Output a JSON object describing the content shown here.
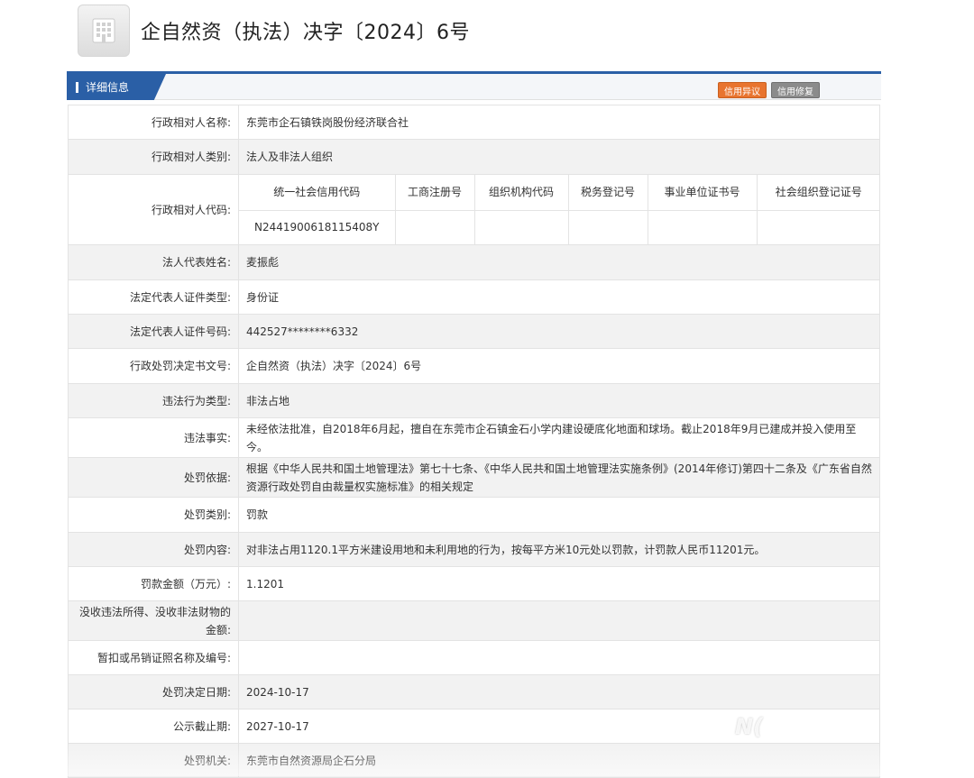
{
  "header": {
    "title": "企自然资（执法）决字〔2024〕6号",
    "logo_icon": "building-icon"
  },
  "section": {
    "tab_label": "详细信息",
    "btn_objection": "信用异议",
    "btn_repair": "信用修复",
    "accent_color": "#2a5fa6",
    "objection_color": "#e8742f",
    "repair_color": "#8b8b8b"
  },
  "rows": {
    "name_label": "行政相对人名称:",
    "name_value": "东莞市企石镇铁岗股份经济联合社",
    "type_label": "行政相对人类别:",
    "type_value": "法人及非法人组织",
    "code_label": "行政相对人代码:",
    "code_headers": [
      "统一社会信用代码",
      "工商注册号",
      "组织机构代码",
      "税务登记号",
      "事业单位证书号",
      "社会组织登记证号"
    ],
    "code_values": [
      "N2441900618115408Y",
      "",
      "",
      "",
      "",
      ""
    ],
    "rep_label": "法人代表姓名:",
    "rep_value": "麦振彪",
    "id_type_label": "法定代表人证件类型:",
    "id_type_value": "身份证",
    "id_no_label": "法定代表人证件号码:",
    "id_no_value": "442527********6332",
    "doc_no_label": "行政处罚决定书文号:",
    "doc_no_value": "企自然资（执法）决字〔2024〕6号",
    "violation_type_label": "违法行为类型:",
    "violation_type_value": "非法占地",
    "facts_label": "违法事实:",
    "facts_value": "未经依法批准，自2018年6月起，擅自在东莞市企石镇金石小学内建设硬底化地面和球场。截止2018年9月已建成并投入使用至今。",
    "basis_label": "处罚依据:",
    "basis_value": "根据《中华人民共和国土地管理法》第七十七条、《中华人民共和国土地管理法实施条例》(2014年修订)第四十二条及《广东省自然资源行政处罚自由裁量权实施标准》的相关规定",
    "penalty_type_label": "处罚类别:",
    "penalty_type_value": "罚款",
    "penalty_content_label": "处罚内容:",
    "penalty_content_value": "对非法占用1120.1平方米建设用地和未利用地的行为，按每平方米10元处以罚款，计罚款人民币11201元。",
    "fine_label": "罚款金额（万元）:",
    "fine_value": "1.1201",
    "confiscate_label": "没收违法所得、没收非法财物的金额:",
    "confiscate_value": "",
    "license_label": "暂扣或吊销证照名称及编号:",
    "license_value": "",
    "date_label": "处罚决定日期:",
    "date_value": "2024-10-17",
    "expire_label": "公示截止期:",
    "expire_value": "2027-10-17",
    "authority_label": "处罚机关:",
    "authority_value": "东莞市自然资源局企石分局"
  },
  "watermark": "N("
}
